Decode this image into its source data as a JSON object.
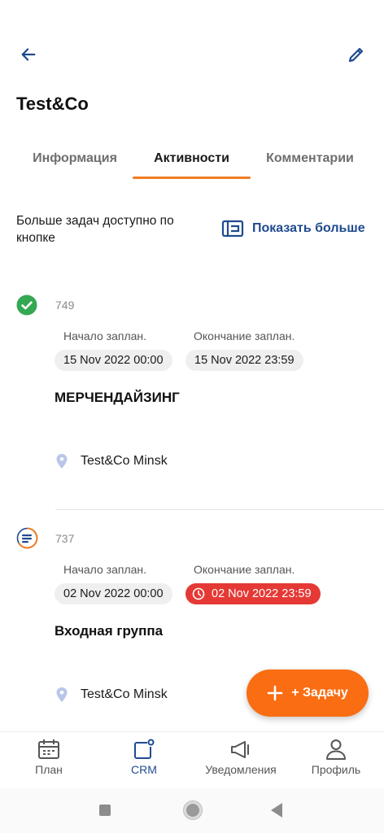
{
  "header": {
    "title": "Test&Co"
  },
  "tabs": [
    {
      "label": "Информация",
      "active": false
    },
    {
      "label": "Активности",
      "active": true
    },
    {
      "label": "Комментарии",
      "active": false
    }
  ],
  "info": {
    "text": "Больше задач доступно по кнопке",
    "show_more_label": "Показать больше"
  },
  "tasks": [
    {
      "number": "749",
      "status_icon": "check-circle-icon",
      "start_label": "Начало заплан.",
      "start_value": "15 Nov 2022 00:00",
      "end_label": "Окончание заплан.",
      "end_value": "15 Nov 2022 23:59",
      "overdue": false,
      "title": "МЕРЧЕНДАЙЗИНГ",
      "location": "Test&Co Minsk"
    },
    {
      "number": "737",
      "status_icon": "in-progress-icon",
      "start_label": "Начало заплан.",
      "start_value": "02 Nov 2022 00:00",
      "end_label": "Окончание заплан.",
      "end_value": "02 Nov 2022 23:59",
      "overdue": true,
      "title": "Входная группа",
      "location": "Test&Co Minsk"
    }
  ],
  "fab": {
    "label": "+ Задачу"
  },
  "nav": [
    {
      "label": "План",
      "icon": "calendar-icon",
      "active": false
    },
    {
      "label": "CRM",
      "icon": "crm-icon",
      "active": true
    },
    {
      "label": "Уведомления",
      "icon": "megaphone-icon",
      "active": false
    },
    {
      "label": "Профиль",
      "icon": "person-icon",
      "active": false
    }
  ],
  "colors": {
    "accent": "#f07c21",
    "fab": "#fa6d12",
    "primary": "#1f4b8f",
    "success": "#34a853",
    "danger": "#e53935"
  }
}
